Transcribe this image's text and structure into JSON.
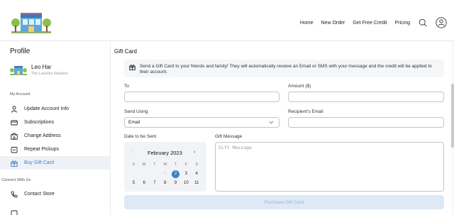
{
  "header": {
    "nav": [
      "Home",
      "New Order",
      "Get Free Credit",
      "Pricing"
    ]
  },
  "sidebar": {
    "title": "Profile",
    "user": {
      "name": "Leo Har",
      "subtitle": "The Laundry Masters"
    },
    "my_account_label": "My Account",
    "items": [
      {
        "label": "Update Account Info",
        "icon": "person-icon"
      },
      {
        "label": "Subscriptions",
        "icon": "card-icon"
      },
      {
        "label": "Change Address",
        "icon": "building-icon"
      },
      {
        "label": "Repeat Pickups",
        "icon": "repeat-icon"
      },
      {
        "label": "Buy Gift Card",
        "icon": "gift-icon",
        "active": true
      }
    ],
    "connect_label": "Connect With Us",
    "connect_items": [
      {
        "label": "Contact Store",
        "icon": "phone-icon"
      }
    ]
  },
  "main": {
    "title": "Gift Card",
    "banner": "Send a Gift Card to your friends and family! They will automatically receive an Email or SMS with your message and the credit will be applied to their account.",
    "to_label": "To",
    "to_value": "",
    "amount_label": "Amount ($)",
    "amount_value": "",
    "send_using_label": "Send Using",
    "send_using_value": "Email",
    "recipient_label": "Recipient's Email",
    "recipient_value": "",
    "date_label": "Date to be Sent",
    "message_label": "Gift Message",
    "message_placeholder": "Gift Message",
    "purchase_label": "Purchase Gift Card",
    "calendar": {
      "month": "February 2023",
      "prev": "‹",
      "next": "›",
      "weekdays": [
        "S",
        "M",
        "T",
        "W",
        "T",
        "F",
        "S"
      ],
      "week1": [
        "",
        "",
        "",
        "1",
        "2",
        "3",
        "4"
      ],
      "week2": [
        "5",
        "6",
        "7",
        "8",
        "9",
        "10",
        "11"
      ],
      "selected": "2"
    }
  },
  "colors": {
    "accent": "#3c7fd0",
    "active_bg": "#eef1f5",
    "button_bg": "#dde9f4"
  }
}
